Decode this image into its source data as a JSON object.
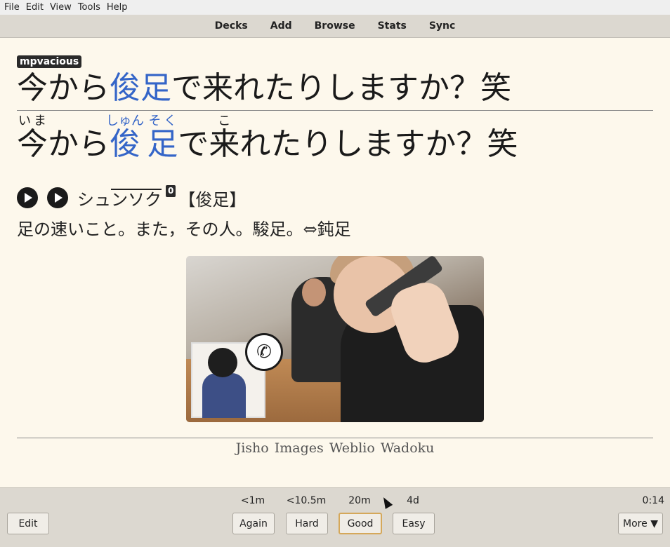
{
  "menu": [
    "File",
    "Edit",
    "View",
    "Tools",
    "Help"
  ],
  "toolbar": [
    "Decks",
    "Add",
    "Browse",
    "Stats",
    "Sync"
  ],
  "card": {
    "tag": "mpvacious",
    "front": {
      "pre": "今から",
      "hl": "俊足",
      "post": "で来れたりしますか？笑"
    },
    "back": {
      "ima": {
        "base": "今",
        "rt": "いま"
      },
      "kara": "から",
      "shun": {
        "base": "俊",
        "rt": "しゅん"
      },
      "soku": {
        "base": "足",
        "rt": "そく"
      },
      "de": "で",
      "ko": {
        "base": "来",
        "rt": "こ"
      },
      "rest": "れたりしますか？笑"
    },
    "dict": {
      "reading_pre": "シュ",
      "reading_over": "ンソク",
      "accent": "0",
      "kanji": "【俊足】",
      "definition": "足の速いこと。また，その人。駿足。⇔鈍足"
    },
    "links": [
      "Jisho",
      "Images",
      "Weblio",
      "Wadoku"
    ]
  },
  "bottom": {
    "intervals": [
      "<1m",
      "<10.5m",
      "20m",
      "4d"
    ],
    "timer": "0:14",
    "edit": "Edit",
    "again": "Again",
    "hard": "Hard",
    "good": "Good",
    "easy": "Easy",
    "more": "More ▼"
  }
}
